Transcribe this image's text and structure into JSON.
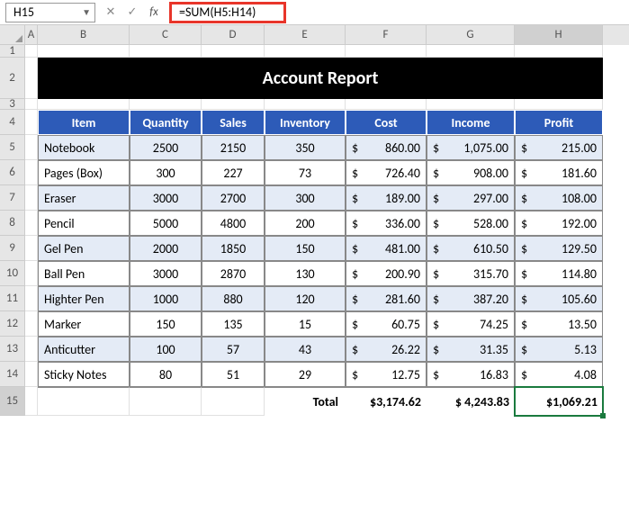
{
  "name_box": "H15",
  "formula": "=SUM(H5:H14)",
  "columns": [
    "A",
    "B",
    "C",
    "D",
    "E",
    "F",
    "G",
    "H"
  ],
  "rows": [
    "1",
    "2",
    "3",
    "4",
    "5",
    "6",
    "7",
    "8",
    "9",
    "10",
    "11",
    "12",
    "13",
    "14",
    "15"
  ],
  "title": "Account Report",
  "headers": [
    "Item",
    "Quantity",
    "Sales",
    "Inventory",
    "Cost",
    "Income",
    "Profit"
  ],
  "data": [
    {
      "item": "Notebook",
      "qty": "2500",
      "sales": "2150",
      "inv": "350",
      "cost": "860.00",
      "income": "1,075.00",
      "profit": "215.00"
    },
    {
      "item": "Pages (Box)",
      "qty": "300",
      "sales": "227",
      "inv": "73",
      "cost": "726.40",
      "income": "908.00",
      "profit": "181.60"
    },
    {
      "item": "Eraser",
      "qty": "3000",
      "sales": "2700",
      "inv": "300",
      "cost": "189.00",
      "income": "297.00",
      "profit": "108.00"
    },
    {
      "item": "Pencil",
      "qty": "5000",
      "sales": "4800",
      "inv": "200",
      "cost": "336.00",
      "income": "528.00",
      "profit": "192.00"
    },
    {
      "item": "Gel Pen",
      "qty": "2000",
      "sales": "1850",
      "inv": "150",
      "cost": "481.00",
      "income": "610.50",
      "profit": "129.50"
    },
    {
      "item": "Ball Pen",
      "qty": "3000",
      "sales": "2870",
      "inv": "130",
      "cost": "200.90",
      "income": "315.70",
      "profit": "114.80"
    },
    {
      "item": "Highter Pen",
      "qty": "1000",
      "sales": "880",
      "inv": "120",
      "cost": "281.60",
      "income": "387.20",
      "profit": "105.60"
    },
    {
      "item": "Marker",
      "qty": "150",
      "sales": "135",
      "inv": "15",
      "cost": "60.75",
      "income": "74.25",
      "profit": "13.50"
    },
    {
      "item": "Anticutter",
      "qty": "100",
      "sales": "57",
      "inv": "43",
      "cost": "26.22",
      "income": "31.35",
      "profit": "5.13"
    },
    {
      "item": "Sticky Notes",
      "qty": "80",
      "sales": "51",
      "inv": "29",
      "cost": "12.75",
      "income": "16.83",
      "profit": "4.08"
    }
  ],
  "totals": {
    "label": "Total",
    "cost": "$3,174.62",
    "income": "$ 4,243.83",
    "profit": "$1,069.21"
  },
  "currency": "$",
  "active_col": "H",
  "active_row": "15"
}
